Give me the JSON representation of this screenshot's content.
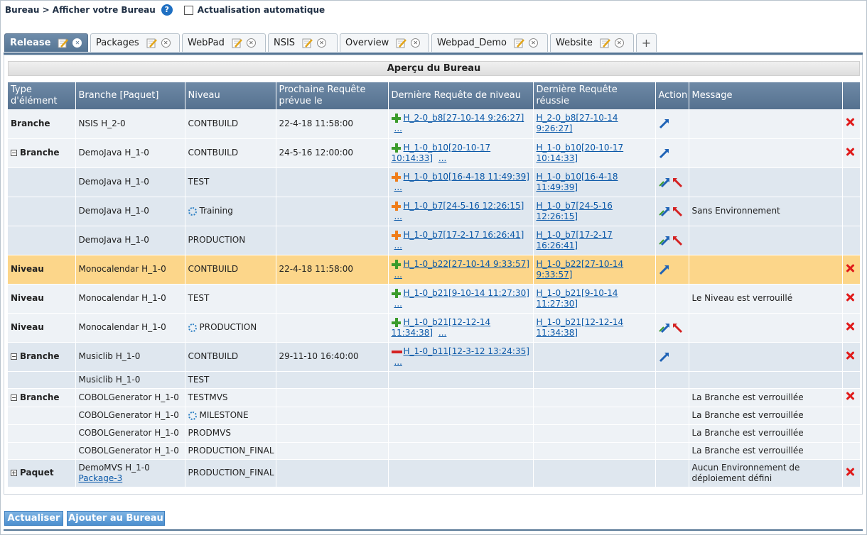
{
  "breadcrumb": "Bureau > Afficher votre Bureau",
  "auto_refresh_label": "Actualisation automatique",
  "tabs": [
    "Release",
    "Packages",
    "WebPad",
    "NSIS",
    "Overview",
    "Webpad_Demo",
    "Website"
  ],
  "panel_title": "Aperçu du Bureau",
  "columns": [
    "Type d'élément",
    "Branche [Paquet]",
    "Niveau",
    "Prochaine Requête prévue le",
    "Dernière Requête de niveau",
    "Dernière Requête réussie",
    "Action",
    "Message"
  ],
  "rows": [
    {
      "type": "Branche",
      "branch": "NSIS H_2-0",
      "level": "CONTBUILD",
      "next": "22-4-18 11:58:00",
      "last_req": "H_2-0_b8[27-10-14 9:26:27]",
      "last_ok": "H_2-0_b8[27-10-14 9:26:27]",
      "message": ""
    },
    {
      "type": "Branche",
      "branch": "DemoJava H_1-0",
      "level": "CONTBUILD",
      "next": "24-5-16 12:00:00",
      "last_req": "H_1-0_b10[20-10-17 10:14:33]",
      "last_ok": "H_1-0_b10[20-10-17 10:14:33]",
      "message": ""
    },
    {
      "type": "",
      "branch": "DemoJava H_1-0",
      "level": "TEST",
      "next": "",
      "last_req": "H_1-0_b10[16-4-18 11:49:39]",
      "last_ok": "H_1-0_b10[16-4-18 11:49:39]",
      "message": ""
    },
    {
      "type": "",
      "branch": "DemoJava H_1-0",
      "level": "Training",
      "next": "",
      "last_req": "H_1-0_b7[24-5-16 12:26:15]",
      "last_ok": "H_1-0_b7[24-5-16 12:26:15]",
      "message": "Sans Environnement"
    },
    {
      "type": "",
      "branch": "DemoJava H_1-0",
      "level": "PRODUCTION",
      "next": "",
      "last_req": "H_1-0_b7[17-2-17 16:26:41]",
      "last_ok": "H_1-0_b7[17-2-17 16:26:41]",
      "message": ""
    },
    {
      "type": "Niveau",
      "branch": "Monocalendar H_1-0",
      "level": "CONTBUILD",
      "next": "22-4-18 11:58:00",
      "last_req": "H_1-0_b22[27-10-14 9:33:57]",
      "last_ok": "H_1-0_b22[27-10-14 9:33:57]",
      "message": ""
    },
    {
      "type": "Niveau",
      "branch": "Monocalendar H_1-0",
      "level": "TEST",
      "next": "",
      "last_req": "H_1-0_b21[9-10-14 11:27:30]",
      "last_ok": "H_1-0_b21[9-10-14 11:27:30]",
      "message": "Le Niveau est verrouillé"
    },
    {
      "type": "Niveau",
      "branch": "Monocalendar H_1-0",
      "level": "PRODUCTION",
      "next": "",
      "last_req": "H_1-0_b21[12-12-14 11:34:38]",
      "last_ok": "H_1-0_b21[12-12-14 11:34:38]",
      "message": ""
    },
    {
      "type": "Branche",
      "branch": "Musiclib H_1-0",
      "level": "CONTBUILD",
      "next": "29-11-10 16:40:00",
      "last_req": "H_1-0_b11[12-3-12 13:24:35]",
      "last_ok": "",
      "message": ""
    },
    {
      "type": "",
      "branch": "Musiclib H_1-0",
      "level": "TEST",
      "next": "",
      "last_req": "",
      "last_ok": "",
      "message": ""
    },
    {
      "type": "Branche",
      "branch": "COBOLGenerator H_1-0",
      "level": "TESTMVS",
      "next": "",
      "last_req": "",
      "last_ok": "",
      "message": "La Branche est verrouillée"
    },
    {
      "type": "",
      "branch": "COBOLGenerator H_1-0",
      "level": "MILESTONE",
      "next": "",
      "last_req": "",
      "last_ok": "",
      "message": "La Branche est verrouillée"
    },
    {
      "type": "",
      "branch": "COBOLGenerator H_1-0",
      "level": "PRODMVS",
      "next": "",
      "last_req": "",
      "last_ok": "",
      "message": "La Branche est verrouillée"
    },
    {
      "type": "",
      "branch": "COBOLGenerator H_1-0",
      "level": "PRODUCTION_FINAL",
      "next": "",
      "last_req": "",
      "last_ok": "",
      "message": "La Branche est verrouillée"
    },
    {
      "type": "Paquet",
      "branch": "DemoMVS H_1-0",
      "package": "Package-3",
      "level": "PRODUCTION_FINAL",
      "next": "",
      "last_req": "",
      "last_ok": "",
      "message": "Aucun Environnement de déploiement défini"
    }
  ],
  "more": "...",
  "buttons": {
    "refresh": "Actualiser",
    "add": "Ajouter au Bureau"
  },
  "colors": {
    "header": "#55718f",
    "highlight": "#fcd68a",
    "row_alt": "#dfe7ef",
    "link": "#0a58a8"
  }
}
